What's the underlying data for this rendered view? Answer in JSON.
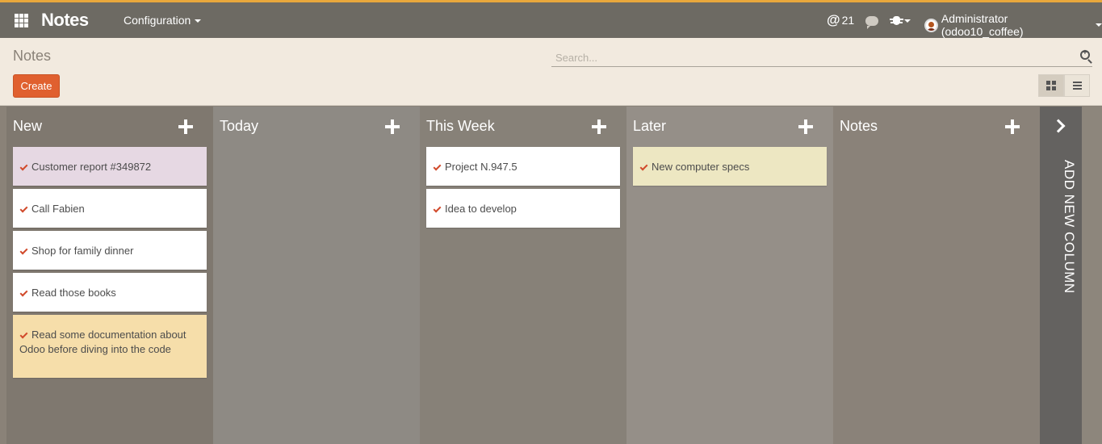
{
  "navbar": {
    "brand": "Notes",
    "menu_configuration": "Configuration",
    "mentions_count": "21",
    "user": "Administrator (odoo10_coffee)"
  },
  "control_panel": {
    "breadcrumb": "Notes",
    "search_placeholder": "Search...",
    "create_label": "Create"
  },
  "kanban": {
    "add_column_label": "ADD NEW COLUMN",
    "columns": [
      {
        "title": "New",
        "bg": "#7f786f",
        "cards": [
          {
            "text": "Customer report #349872",
            "color": "#e6d8e3"
          },
          {
            "text": "Call Fabien",
            "color": "#ffffff"
          },
          {
            "text": "Shop for family dinner",
            "color": "#ffffff"
          },
          {
            "text": "Read those books",
            "color": "#ffffff"
          },
          {
            "text": "Read some documentation about Odoo before diving into the code",
            "color": "#f6deaa"
          }
        ]
      },
      {
        "title": "Today",
        "bg": "#8e8a84",
        "cards": []
      },
      {
        "title": "This Week",
        "bg": "#878178",
        "cards": [
          {
            "text": "Project N.947.5",
            "color": "#ffffff"
          },
          {
            "text": "Idea to develop",
            "color": "#ffffff"
          }
        ]
      },
      {
        "title": "Later",
        "bg": "#958f88",
        "cards": [
          {
            "text": "New computer specs",
            "color": "#ede7c2"
          }
        ]
      },
      {
        "title": "Notes",
        "bg": "#8a8279",
        "cards": []
      }
    ]
  },
  "colors": {
    "navbar": "#6d6a63",
    "navbar_accent": "#e8a73c",
    "control_panel": "#f2eadf",
    "create_button": "#e0602f",
    "check": "#d14a2b"
  }
}
